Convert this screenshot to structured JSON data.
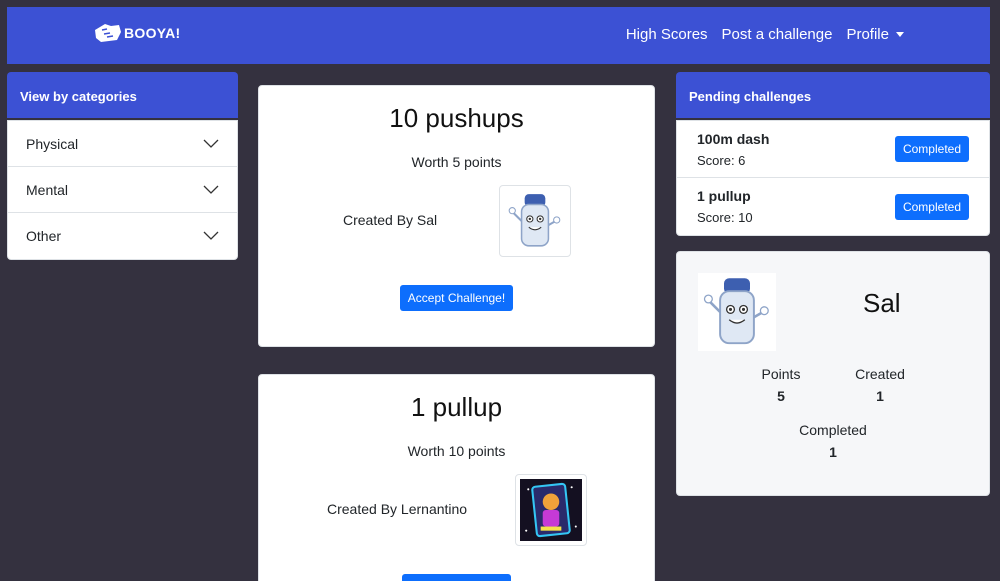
{
  "nav": {
    "brand": "BOOYA!",
    "links": [
      "High Scores",
      "Post a challenge"
    ],
    "profile": "Profile"
  },
  "categories": {
    "header": "View by categories",
    "items": [
      "Physical",
      "Mental",
      "Other"
    ]
  },
  "challenges": [
    {
      "title": "10 pushups",
      "worth": "Worth 5 points",
      "creator": "Created By Sal",
      "button": "Accept Challenge!"
    },
    {
      "title": "1 pullup",
      "worth": "Worth 10 points",
      "creator": "Created By Lernantino"
    }
  ],
  "pending": {
    "header": "Pending challenges",
    "items": [
      {
        "name": "100m dash",
        "score": "Score: 6",
        "button": "Completed"
      },
      {
        "name": "1 pullup",
        "score": "Score: 10",
        "button": "Completed"
      }
    ]
  },
  "profile": {
    "name": "Sal",
    "points_label": "Points",
    "points": "5",
    "created_label": "Created",
    "created": "1",
    "completed_label": "Completed",
    "completed": "1"
  },
  "colors": {
    "background": "#34313f",
    "primary": "#3c51d4",
    "button": "#0d6efd"
  },
  "icons": [
    "booya-logo-icon",
    "chevron-down-icon",
    "caret-down-icon",
    "salt-shaker-avatar",
    "neon-card-avatar"
  ]
}
